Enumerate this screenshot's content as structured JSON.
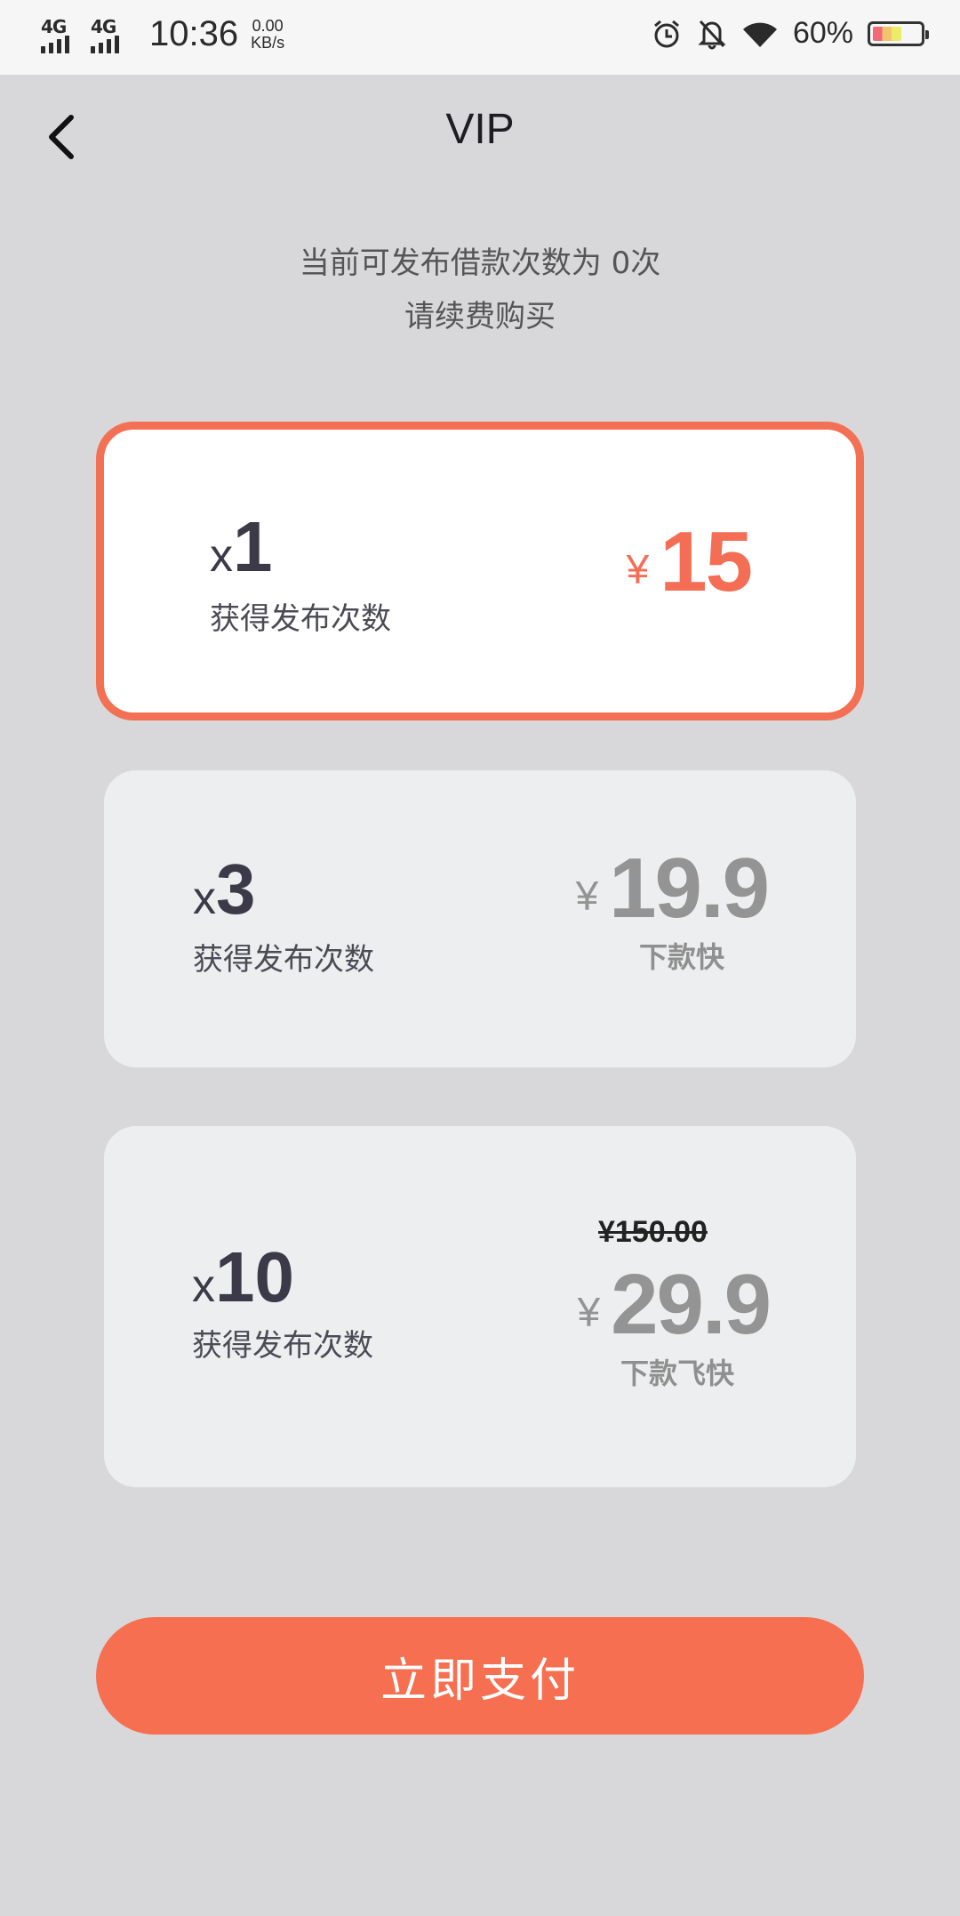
{
  "status_bar": {
    "network_1": "4G",
    "network_2": "4G",
    "time": "10:36",
    "speed_value": "0.00",
    "speed_unit": "KB/s",
    "battery": "60%",
    "icons": [
      "alarm-icon",
      "mute-bell-icon",
      "wifi-icon",
      "battery-icon"
    ]
  },
  "header": {
    "back_icon": "chevron-left-icon",
    "title": "VIP"
  },
  "notice": {
    "line1": "当前可发布借款次数为 0次",
    "line2": "请续费购买"
  },
  "plans": [
    {
      "prefix": "x",
      "count": "1",
      "caption": "获得发布次数",
      "currency": "¥",
      "price": "15",
      "tag": "",
      "original_price": "",
      "selected": true
    },
    {
      "prefix": "x",
      "count": "3",
      "caption": "获得发布次数",
      "currency": "¥",
      "price": "19.9",
      "tag": "下款快",
      "original_price": "",
      "selected": false
    },
    {
      "prefix": "x",
      "count": "10",
      "caption": "获得发布次数",
      "currency": "¥",
      "price": "29.9",
      "tag": "下款飞快",
      "original_price": "¥150.00",
      "selected": false
    }
  ],
  "pay_button": {
    "label": "立即支付"
  },
  "colors": {
    "accent": "#f56f50",
    "background": "#d8d8db",
    "card": "#eceeef",
    "price_gray": "#949494"
  }
}
